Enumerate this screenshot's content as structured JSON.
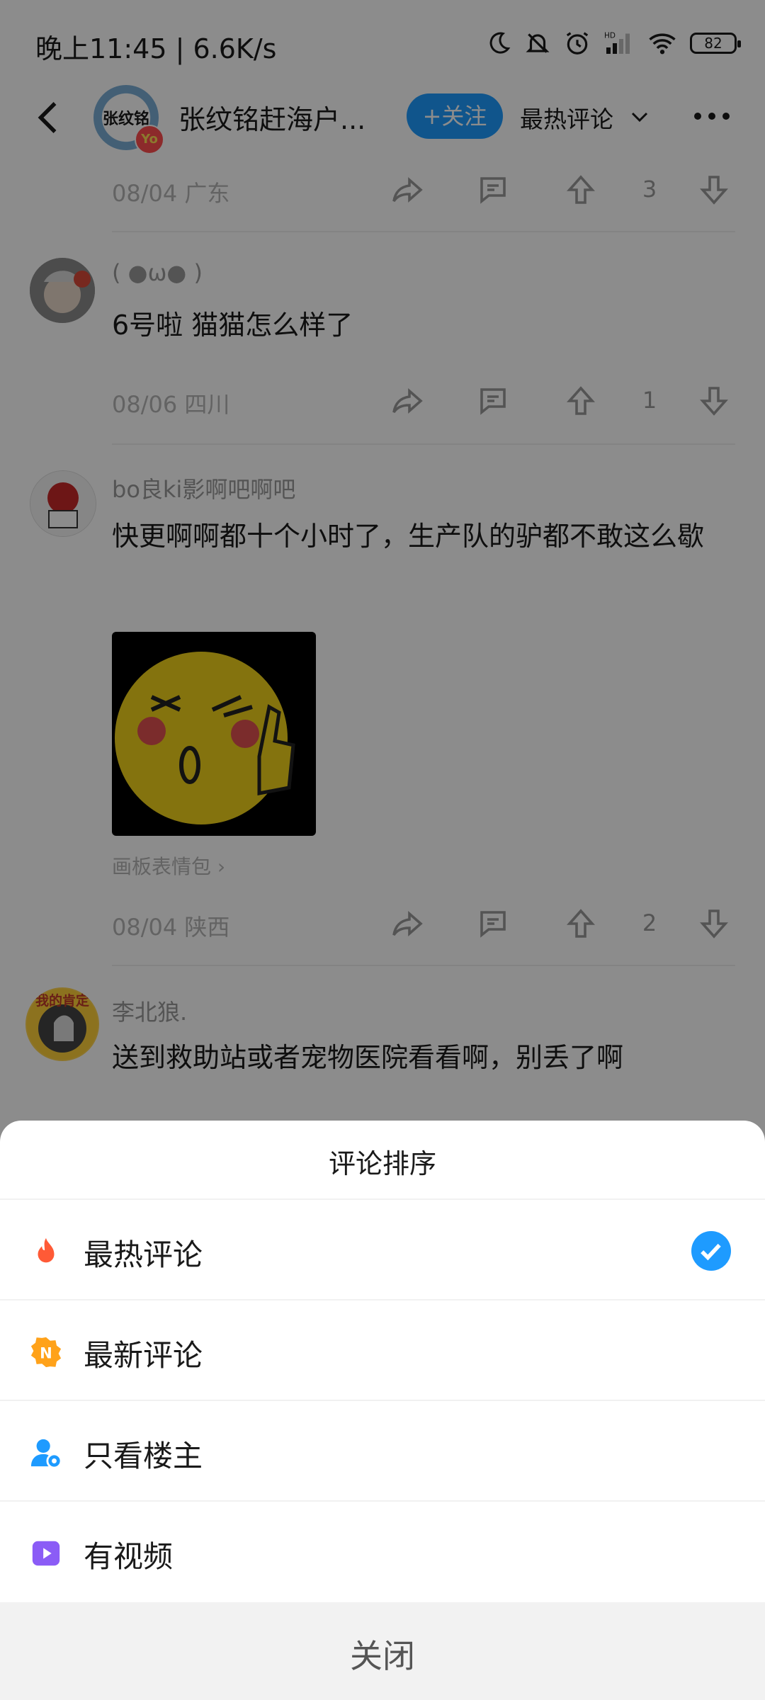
{
  "status_bar": {
    "time": "晚上11:45 | 6.6K/s",
    "battery": "82",
    "network_badge": "HD"
  },
  "header": {
    "title": "张纹铭赶海户...",
    "avatar_text": "张纹铭",
    "vip_badge": "Yo",
    "follow_label": "+关注",
    "sort_label": "最热评论"
  },
  "comments": [
    {
      "date_location": "08/04 广东",
      "likes": "3"
    },
    {
      "username": "( ●ω● )",
      "text": "6号啦 猫猫怎么样了",
      "date_location": "08/06 四川",
      "likes": "1"
    },
    {
      "username": "bo良ki影啊吧啊吧",
      "text": "快更啊啊都十个小时了，生产队的驴都不敢这么歇",
      "sticker_link": "画板表情包 ›",
      "date_location": "08/04 陕西",
      "likes": "2"
    },
    {
      "username": "李北狼.",
      "avatar_text": "我的肯定",
      "text": "送到救助站或者宠物医院看看啊，别丢了啊"
    }
  ],
  "sheet": {
    "title": "评论排序",
    "options": [
      {
        "label": "最热评论",
        "icon": "flame-icon",
        "selected": true
      },
      {
        "label": "最新评论",
        "icon": "new-badge-icon"
      },
      {
        "label": "只看楼主",
        "icon": "user-eye-icon"
      },
      {
        "label": "有视频",
        "icon": "video-icon"
      }
    ],
    "close_label": "关闭"
  },
  "colors": {
    "accent": "#1e9bff",
    "flame": "#ff5a36",
    "new_badge": "#ffa21a",
    "video": "#8b5cf6"
  }
}
